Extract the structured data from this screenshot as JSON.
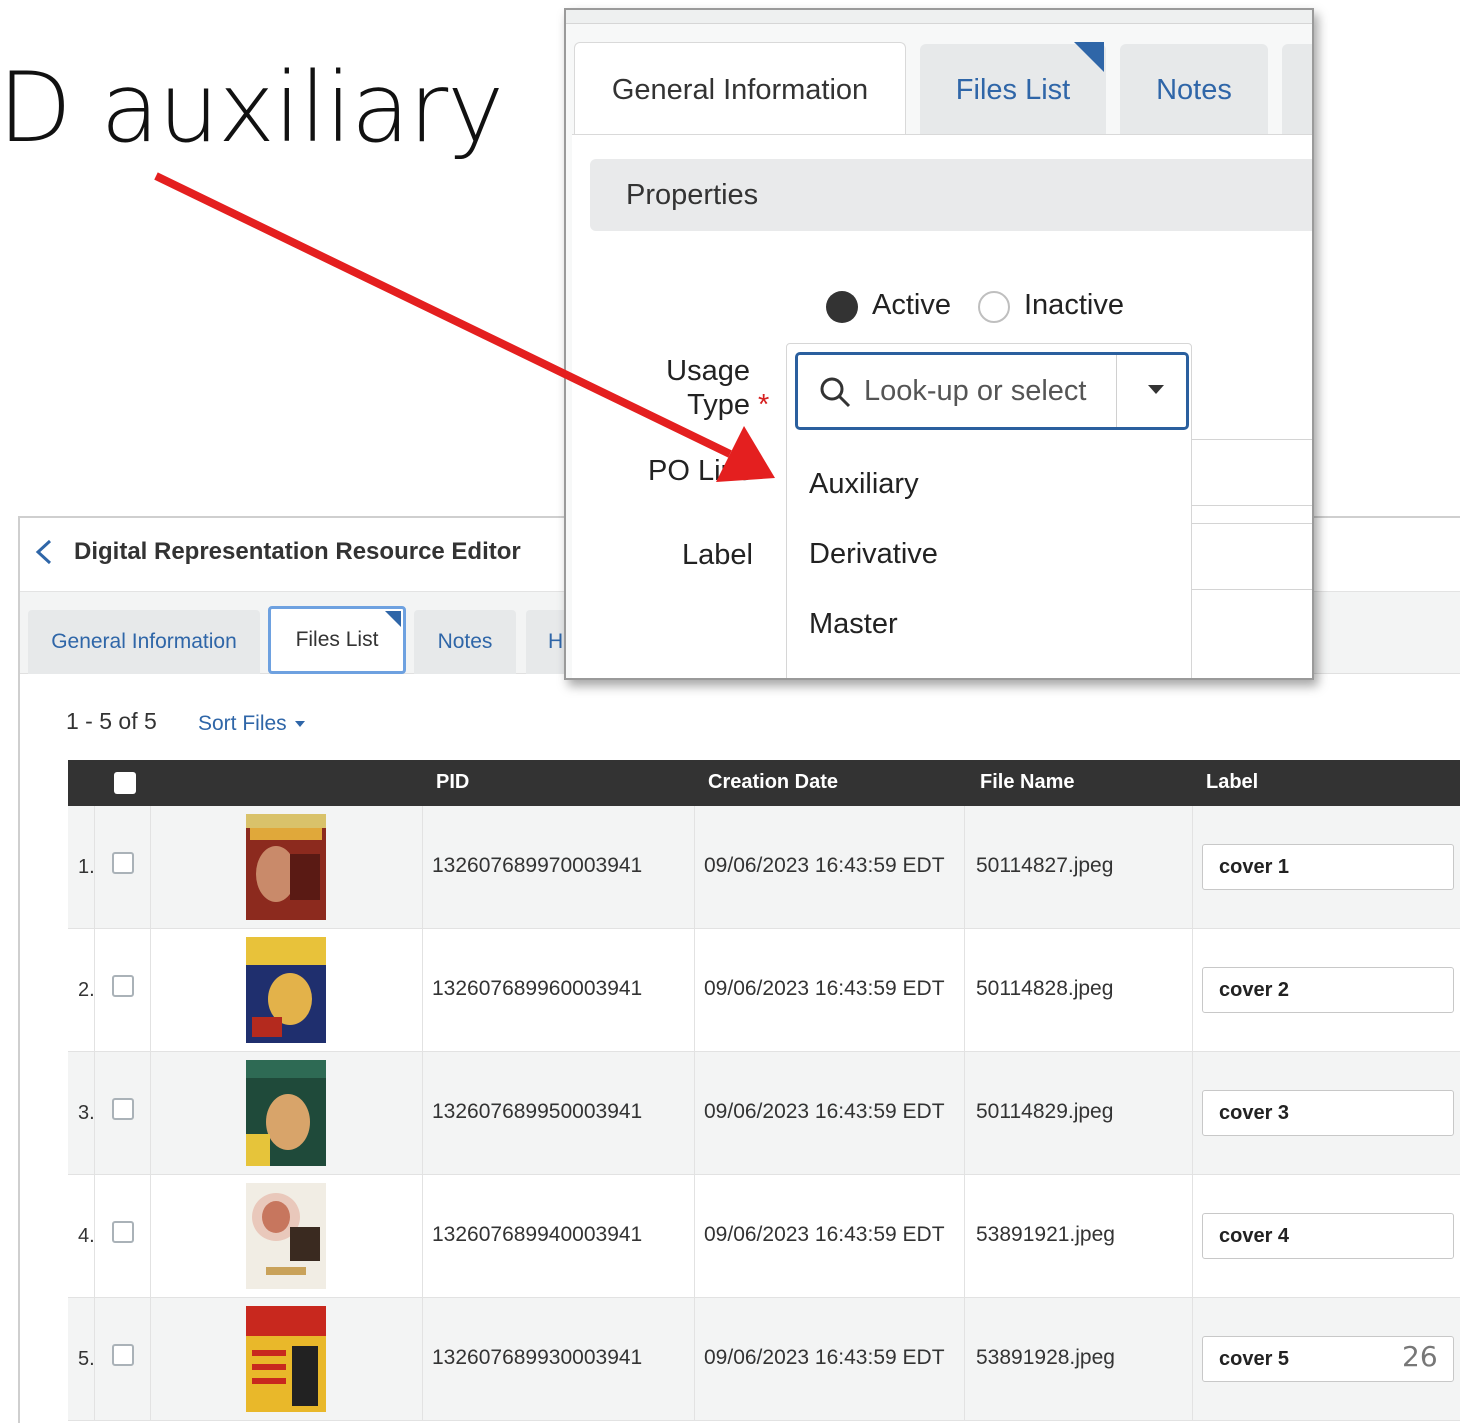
{
  "slide": {
    "title": "D auxiliary",
    "page_number": "26"
  },
  "colors": {
    "accent_blue": "#2f66a8",
    "arrow_red": "#e41f1f",
    "table_header": "#333333",
    "required": "#d62020"
  },
  "editor": {
    "title": "Digital Representation Resource Editor",
    "back_icon": "chevron-left-icon",
    "tabs": [
      {
        "label": "General Information"
      },
      {
        "label": "Files List"
      },
      {
        "label": "Notes"
      },
      {
        "label": "H"
      }
    ],
    "count": "1 - 5 of 5",
    "sort_label": "Sort Files",
    "table": {
      "headers": {
        "pid": "PID",
        "creation_date": "Creation Date",
        "file_name": "File Name",
        "label": "Label"
      },
      "rows": [
        {
          "index": "1.",
          "pid": "132607689970003941",
          "creation_date": "09/06/2023 16:43:59 EDT",
          "file_name": "50114827.jpeg",
          "label": "cover 1"
        },
        {
          "index": "2.",
          "pid": "132607689960003941",
          "creation_date": "09/06/2023 16:43:59 EDT",
          "file_name": "50114828.jpeg",
          "label": "cover 2"
        },
        {
          "index": "3.",
          "pid": "132607689950003941",
          "creation_date": "09/06/2023 16:43:59 EDT",
          "file_name": "50114829.jpeg",
          "label": "cover 3"
        },
        {
          "index": "4.",
          "pid": "132607689940003941",
          "creation_date": "09/06/2023 16:43:59 EDT",
          "file_name": "53891921.jpeg",
          "label": "cover 4"
        },
        {
          "index": "5.",
          "pid": "132607689930003941",
          "creation_date": "09/06/2023 16:43:59 EDT",
          "file_name": "53891928.jpeg",
          "label": "cover 5"
        }
      ]
    }
  },
  "popup": {
    "tabs": [
      {
        "label": "General Information"
      },
      {
        "label": "Files List"
      },
      {
        "label": "Notes"
      }
    ],
    "section": "Properties",
    "status": {
      "active": "Active",
      "inactive": "Inactive"
    },
    "usage_type_label_1": "Usage",
    "usage_type_label_2": "Type",
    "required_mark": "*",
    "po_line_label": "PO Line",
    "label_label": "Label",
    "lookup_placeholder": "Look-up or select",
    "options": [
      "Auxiliary",
      "Derivative",
      "Master"
    ]
  }
}
